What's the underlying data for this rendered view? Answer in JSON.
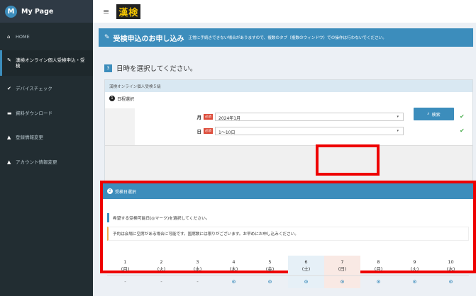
{
  "brand": {
    "logo_letter": "M",
    "title": "My Page"
  },
  "topbar": {
    "hamburger": "≡",
    "logo_text": "漢検"
  },
  "sidebar": {
    "items": [
      {
        "icon": "home-icon",
        "glyph": "⌂",
        "label": "HOME"
      },
      {
        "icon": "pencil-icon",
        "glyph": "✎",
        "label": "漢検オンライン個人受検申込・受検"
      },
      {
        "icon": "check-icon",
        "glyph": "✔",
        "label": "デバイスチェック"
      },
      {
        "icon": "folder-icon",
        "glyph": "▬",
        "label": "資料ダウンロード"
      },
      {
        "icon": "user-icon",
        "glyph": "▲",
        "label": "登録情報変更"
      },
      {
        "icon": "lock-icon",
        "glyph": "▲",
        "label": "アカウント情報変更"
      }
    ]
  },
  "header": {
    "title": "受検申込のお申し込み",
    "note": "正常に手続きできない場合がありますので、複数のタブ（複数のウィンドウ）での操作は行わないでください。"
  },
  "step": {
    "number": "3",
    "text": "日時を選択してください。"
  },
  "panel1": {
    "subtitle": "漢検オンライン個人受検５級",
    "section": {
      "number": "1",
      "label": "日程選択"
    },
    "month_label": "月",
    "day_label": "日",
    "required": "必須",
    "month_value": "2024年1月",
    "day_value": "1〜10日",
    "search_label": "検索"
  },
  "panel2": {
    "section": {
      "number": "2",
      "label": "受検日選択"
    },
    "instruction": "希望する受検可能日(◎マーク)を選択してください。",
    "warning": "予約は会場に空席がある場合に可能です。国席数には限りがございます。お早めにお申し込みください。",
    "days": [
      {
        "day": "1",
        "weekday": "(月)",
        "status": "-"
      },
      {
        "day": "2",
        "weekday": "(火)",
        "status": "-"
      },
      {
        "day": "3",
        "weekday": "(水)",
        "status": "-"
      },
      {
        "day": "4",
        "weekday": "(木)",
        "status": "⊙"
      },
      {
        "day": "5",
        "weekday": "(金)",
        "status": "⊙"
      },
      {
        "day": "6",
        "weekday": "(土)",
        "status": "⊙"
      },
      {
        "day": "7",
        "weekday": "(日)",
        "status": "⊙"
      },
      {
        "day": "8",
        "weekday": "(月)",
        "status": "⊙"
      },
      {
        "day": "9",
        "weekday": "(火)",
        "status": "⊙"
      },
      {
        "day": "10",
        "weekday": "(水)",
        "status": "⊙"
      }
    ]
  },
  "colors": {
    "accent": "#3c8dbc",
    "sidebar": "#222d32",
    "highlight": "#ee0000",
    "ok": "#4caf50"
  }
}
